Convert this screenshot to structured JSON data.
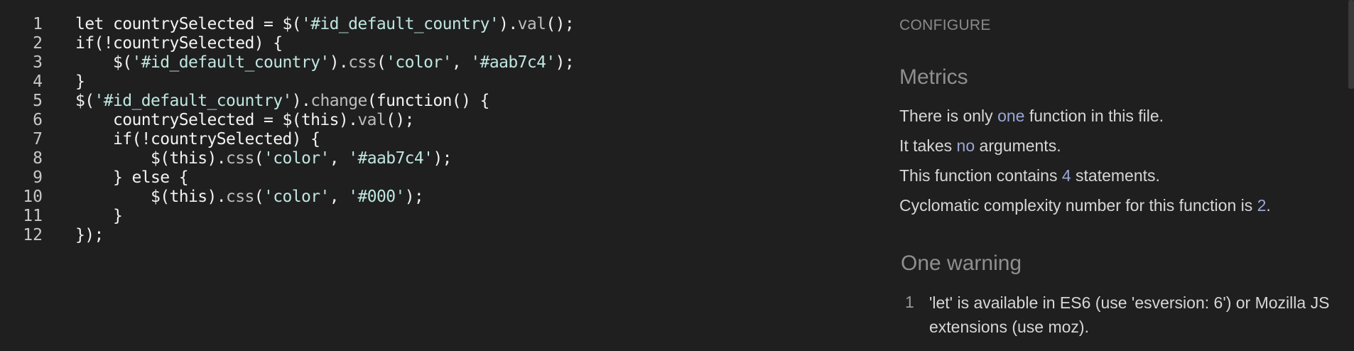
{
  "editor": {
    "lines": [
      {
        "n": "1",
        "tokens": [
          {
            "t": "let countrySelected = $(",
            "c": "tk-pl"
          },
          {
            "t": "'#id_default_country'",
            "c": "tk-str"
          },
          {
            "t": ").",
            "c": "tk-pl"
          },
          {
            "t": "val",
            "c": "tk-fn"
          },
          {
            "t": "();",
            "c": "tk-pl"
          }
        ]
      },
      {
        "n": "2",
        "tokens": [
          {
            "t": "if(!countrySelected) {",
            "c": "tk-pl"
          }
        ]
      },
      {
        "n": "3",
        "tokens": [
          {
            "t": "    $(",
            "c": "tk-pl"
          },
          {
            "t": "'#id_default_country'",
            "c": "tk-str"
          },
          {
            "t": ").",
            "c": "tk-pl"
          },
          {
            "t": "css",
            "c": "tk-fn"
          },
          {
            "t": "(",
            "c": "tk-pl"
          },
          {
            "t": "'color'",
            "c": "tk-str"
          },
          {
            "t": ", ",
            "c": "tk-pl"
          },
          {
            "t": "'#aab7c4'",
            "c": "tk-str"
          },
          {
            "t": ");",
            "c": "tk-pl"
          }
        ]
      },
      {
        "n": "4",
        "tokens": [
          {
            "t": "}",
            "c": "tk-pl"
          }
        ]
      },
      {
        "n": "5",
        "tokens": [
          {
            "t": "$(",
            "c": "tk-pl"
          },
          {
            "t": "'#id_default_country'",
            "c": "tk-str"
          },
          {
            "t": ").",
            "c": "tk-pl"
          },
          {
            "t": "change",
            "c": "tk-fn"
          },
          {
            "t": "(function() {",
            "c": "tk-pl"
          }
        ]
      },
      {
        "n": "6",
        "tokens": [
          {
            "t": "    countrySelected = $(this).",
            "c": "tk-pl"
          },
          {
            "t": "val",
            "c": "tk-fn"
          },
          {
            "t": "();",
            "c": "tk-pl"
          }
        ]
      },
      {
        "n": "7",
        "tokens": [
          {
            "t": "    if(!countrySelected) {",
            "c": "tk-pl"
          }
        ]
      },
      {
        "n": "8",
        "tokens": [
          {
            "t": "        $(this).",
            "c": "tk-pl"
          },
          {
            "t": "css",
            "c": "tk-fn"
          },
          {
            "t": "(",
            "c": "tk-pl"
          },
          {
            "t": "'color'",
            "c": "tk-str"
          },
          {
            "t": ", ",
            "c": "tk-pl"
          },
          {
            "t": "'#aab7c4'",
            "c": "tk-str"
          },
          {
            "t": ");",
            "c": "tk-pl"
          }
        ]
      },
      {
        "n": "9",
        "tokens": [
          {
            "t": "    } else {",
            "c": "tk-pl"
          }
        ]
      },
      {
        "n": "10",
        "tokens": [
          {
            "t": "        $(this).",
            "c": "tk-pl"
          },
          {
            "t": "css",
            "c": "tk-fn"
          },
          {
            "t": "(",
            "c": "tk-pl"
          },
          {
            "t": "'color'",
            "c": "tk-str"
          },
          {
            "t": ", ",
            "c": "tk-pl"
          },
          {
            "t": "'#000'",
            "c": "tk-str"
          },
          {
            "t": ");",
            "c": "tk-pl"
          }
        ]
      },
      {
        "n": "11",
        "tokens": [
          {
            "t": "    }",
            "c": "tk-pl"
          }
        ]
      },
      {
        "n": "12",
        "tokens": [
          {
            "t": "});",
            "c": "tk-pl"
          }
        ]
      }
    ]
  },
  "panel": {
    "configure_label": "CONFIGURE",
    "metrics_title": "Metrics",
    "metrics": {
      "m1": {
        "pre": "There is only ",
        "hl": "one",
        "post": " function in this file."
      },
      "m2": {
        "pre": "It takes ",
        "hl": "no",
        "post": " arguments."
      },
      "m3": {
        "pre": "This function contains ",
        "hl": "4",
        "post": " statements."
      },
      "m4": {
        "pre": "Cyclomatic complexity number for this function is ",
        "hl": "2",
        "post": "."
      }
    },
    "warnings_title": "One warning",
    "warning": {
      "number": "1",
      "text": "'let' is available in ES6 (use 'esversion: 6') or Mozilla JS extensions (use moz)."
    }
  },
  "colors": {
    "background": "#1f1f1f",
    "string": "#bfe6df",
    "highlight": "#9aa8d6"
  }
}
